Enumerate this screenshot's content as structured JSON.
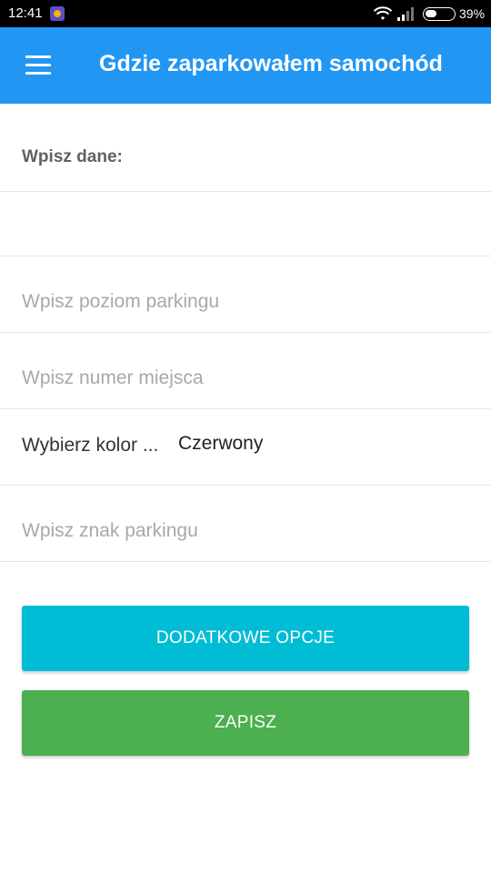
{
  "status_bar": {
    "time": "12:41",
    "battery": "39%",
    "icons": [
      "app-notification-icon",
      "wifi-icon",
      "signal-icon",
      "battery-icon"
    ]
  },
  "app_bar": {
    "title": "Gdzie zaparkowałem samochód",
    "menu_icon": "hamburger-menu-icon",
    "color": "#2196f3"
  },
  "form": {
    "section_label": "Wpisz dane:",
    "parking_level_placeholder": "Wpisz poziom parkingu",
    "spot_number_placeholder": "Wpisz numer miejsca",
    "color_label": "Wybierz kolor ...",
    "color_value": "Czerwony",
    "parking_sign_placeholder": "Wpisz znak parkingu"
  },
  "buttons": {
    "more_options": "Dodatkowe opcje",
    "save": "Zapisz",
    "more_options_color": "#00bcd4",
    "save_color": "#4caf50"
  }
}
